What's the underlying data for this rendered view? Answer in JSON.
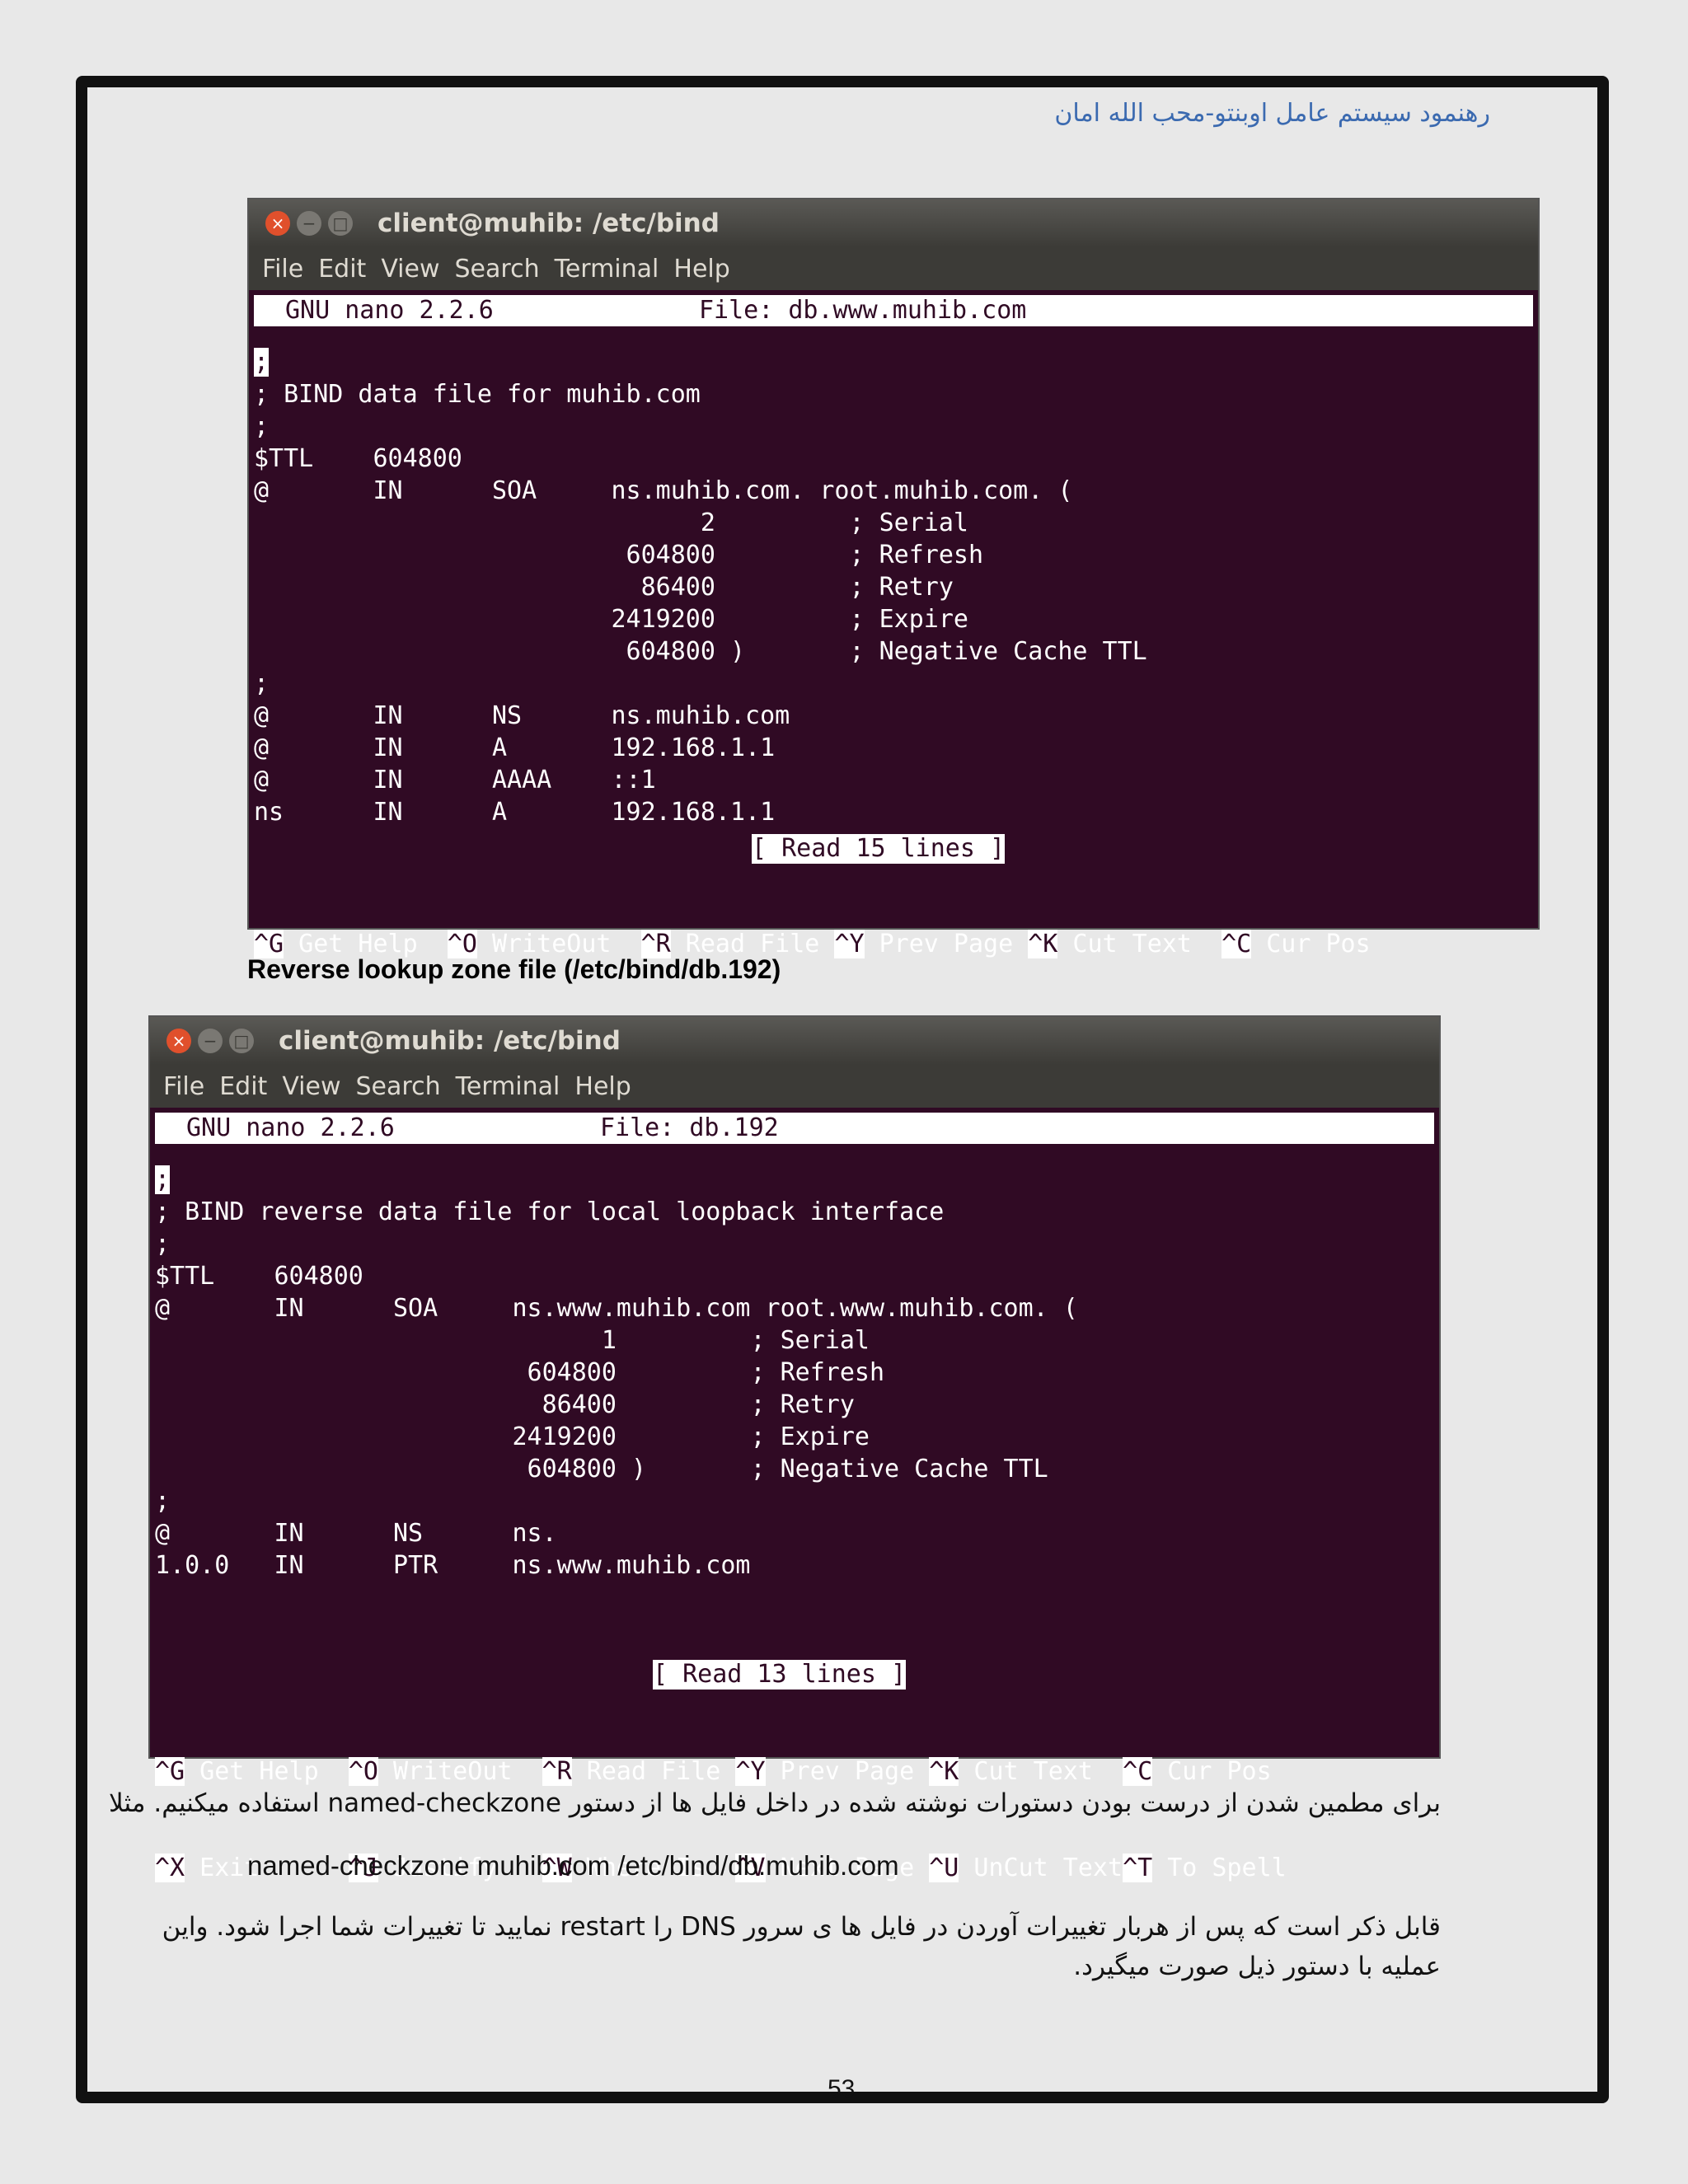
{
  "header": "رهنمود سیستم عامل اوبنتو-محب الله امان",
  "term1": {
    "title": "client@muhib: /etc/bind",
    "menu": [
      "File",
      "Edit",
      "View",
      "Search",
      "Terminal",
      "Help"
    ],
    "nano_version": "GNU nano 2.2.6",
    "file_label": "File: db.www.muhib.com",
    "lines": [
      ";",
      "; BIND data file for muhib.com",
      ";",
      "$TTL    604800",
      "@       IN      SOA     ns.muhib.com. root.muhib.com. (",
      "                              2         ; Serial",
      "                         604800         ; Refresh",
      "                          86400         ; Retry",
      "                        2419200         ; Expire",
      "                         604800 )       ; Negative Cache TTL",
      ";",
      "@       IN      NS      ns.muhib.com",
      "@       IN      A       192.168.1.1",
      "@       IN      AAAA    ::1",
      "ns      IN      A       192.168.1.1"
    ],
    "status": "[ Read 15 lines ]"
  },
  "caption": "Reverse lookup zone file (/etc/bind/db.192)",
  "term2": {
    "title": "client@muhib: /etc/bind",
    "menu": [
      "File",
      "Edit",
      "View",
      "Search",
      "Terminal",
      "Help"
    ],
    "nano_version": "GNU nano 2.2.6",
    "file_label": "File: db.192",
    "lines": [
      ";",
      "; BIND reverse data file for local loopback interface",
      ";",
      "$TTL    604800",
      "@       IN      SOA     ns.www.muhib.com root.www.muhib.com. (",
      "                              1         ; Serial",
      "                         604800         ; Refresh",
      "                          86400         ; Retry",
      "                        2419200         ; Expire",
      "                         604800 )       ; Negative Cache TTL",
      ";",
      "@       IN      NS      ns.",
      "1.0.0   IN      PTR     ns.www.muhib.com"
    ],
    "status": "[ Read 13 lines ]"
  },
  "shortcuts": {
    "row1": [
      {
        "key": "^G",
        "label": " Get Help  "
      },
      {
        "key": "^O",
        "label": " WriteOut  "
      },
      {
        "key": "^R",
        "label": " Read File "
      },
      {
        "key": "^Y",
        "label": " Prev Page "
      },
      {
        "key": "^K",
        "label": " Cut Text  "
      },
      {
        "key": "^C",
        "label": " Cur Pos"
      }
    ],
    "row2": [
      {
        "key": "^X",
        "label": " Exit      "
      },
      {
        "key": "^J",
        "label": " Justify   "
      },
      {
        "key": "^W",
        "label": " Where Is  "
      },
      {
        "key": "^V",
        "label": " Next Page "
      },
      {
        "key": "^U",
        "label": " UnCut Text"
      },
      {
        "key": "^T",
        "label": " To Spell"
      }
    ]
  },
  "para1": "برای مطمین شدن از درست بودن دستورات نوشته شده در داخل فایل ها از دستور named-checkzone استفاده میکنیم. مثلا",
  "command": "named-checkzone muhib.com /etc/bind/db.muhib.com",
  "para2_line1": "قابل ذکر است که پس از هربار تغییرات آوردن در فایل ها ی سرور DNS را restart نمایید تا تغییرات شما اجرا شود. واین",
  "para2_line2": "عملیه با دستور ذیل صورت میگیرد.",
  "page_number": "53"
}
